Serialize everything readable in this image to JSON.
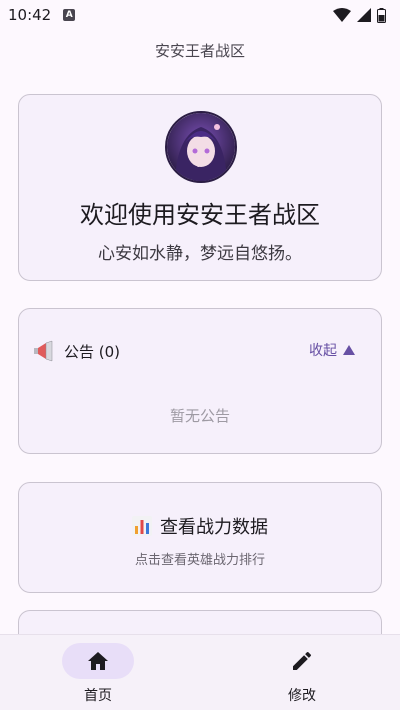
{
  "status_bar": {
    "time": "10:42",
    "indicator": "A"
  },
  "app": {
    "title": "安安王者战区"
  },
  "welcome": {
    "title": "欢迎使用安安王者战区",
    "subtitle": "心安如水静，梦远自悠扬。"
  },
  "notice": {
    "icon": "megaphone-icon",
    "title": "公告 (0)",
    "collapse_label": "收起",
    "empty_text": "暂无公告"
  },
  "stats": {
    "icon": "bar-chart-icon",
    "title": "查看战力数据",
    "subtitle": "点击查看英雄战力排行"
  },
  "bottom_nav": {
    "items": [
      {
        "label": "首页",
        "icon": "home-icon",
        "active": true
      },
      {
        "label": "修改",
        "icon": "edit-icon",
        "active": false
      }
    ]
  },
  "colors": {
    "accent": "#6750a4",
    "active_pill": "#e8def8"
  }
}
